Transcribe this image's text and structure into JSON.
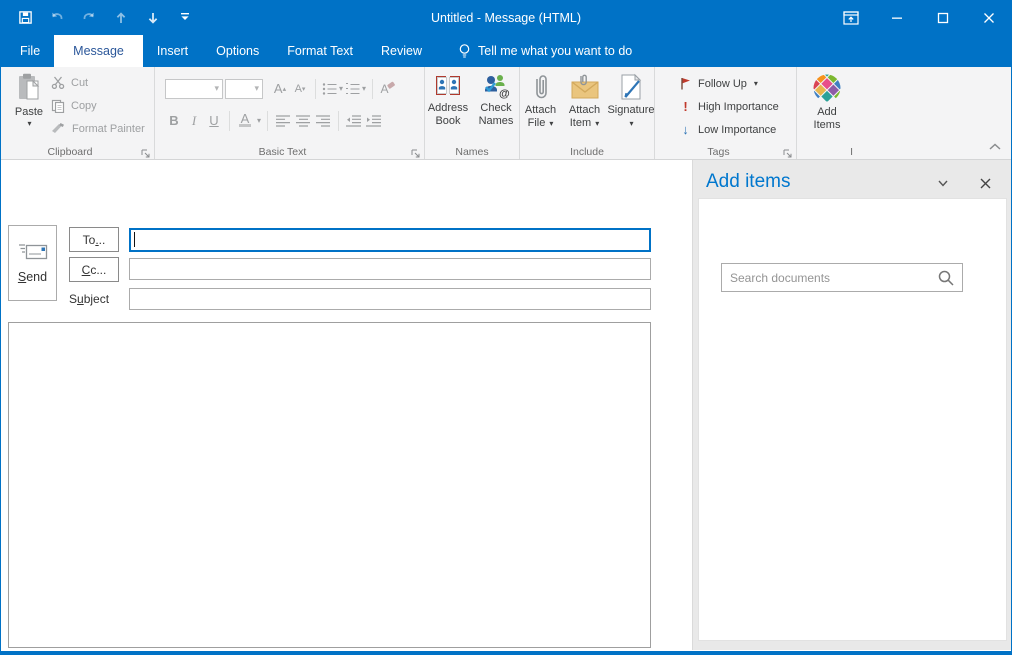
{
  "colors": {
    "titlebar_blue": "#0072C6",
    "accent_blue": "#0072C6",
    "active_tab_text": "#2b579a",
    "ribbon_bg": "#f4f4f5",
    "disabled_gray": "#9ea0a2",
    "pane_bg": "#e9e9e9",
    "pane_title_blue": "#0077ce",
    "flag_red": "#c0392b",
    "importance_red": "#c0392b",
    "low_importance_blue": "#2e75b6"
  },
  "icons": {
    "dropdown_arrow": "▾",
    "exclamation": "!",
    "down_arrow": "↓",
    "up_arrow": "↑",
    "at_sign": "@",
    "ellipsis_note": ""
  },
  "titlebar": {
    "title": "Untitled - Message (HTML)"
  },
  "tabs": [
    {
      "label": "File",
      "active": false
    },
    {
      "label": "Message",
      "active": true
    },
    {
      "label": "Insert",
      "active": false
    },
    {
      "label": "Options",
      "active": false
    },
    {
      "label": "Format Text",
      "active": false
    },
    {
      "label": "Review",
      "active": false
    }
  ],
  "tellme": {
    "label": "Tell me what you want to do"
  },
  "ribbon": {
    "clipboard": {
      "label": "Clipboard",
      "paste": "Paste",
      "cut": "Cut",
      "copy": "Copy",
      "format_painter": "Format Painter"
    },
    "basic_text": {
      "label": "Basic Text",
      "bold": "B",
      "italic": "I",
      "underline": "U",
      "grow_font": "A",
      "shrink_font": "A",
      "font_color": "A",
      "clear_formatting": "A",
      "font_name_value": "",
      "font_size_value": ""
    },
    "names": {
      "label": "Names",
      "address_book_line1": "Address",
      "address_book_line2": "Book",
      "check_names_line1": "Check",
      "check_names_line2": "Names"
    },
    "include": {
      "label": "Include",
      "attach_file_line1": "Attach",
      "attach_file_line2": "File",
      "attach_item_line1": "Attach",
      "attach_item_line2": "Item",
      "signature": "Signature"
    },
    "tags": {
      "label": "Tags",
      "follow_up": "Follow Up",
      "high_importance": "High Importance",
      "low_importance": "Low Importance"
    },
    "addin": {
      "label": "I",
      "add_items_line1": "Add",
      "add_items_line2": "Items"
    }
  },
  "compose": {
    "send": {
      "u": "S",
      "post": "end"
    },
    "to_button": {
      "pre": "To",
      "u": ".",
      "post": ".."
    },
    "cc_button": {
      "u": "C",
      "post": "c..."
    },
    "subject_label": {
      "pre": "S",
      "u": "u",
      "post": "bject"
    },
    "to_value": "",
    "cc_value": "",
    "subject_value": "",
    "body_value": ""
  },
  "taskpane": {
    "title": "Add items",
    "search_placeholder": "Search documents",
    "search_value": ""
  }
}
